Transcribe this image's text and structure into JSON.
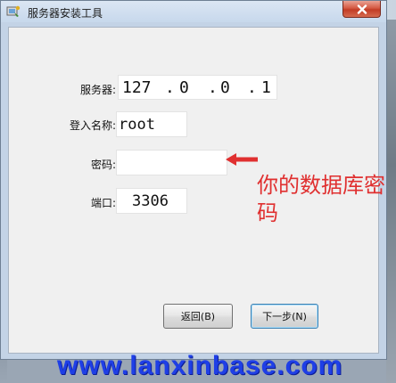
{
  "window": {
    "title": "服务器安装工具",
    "close_icon": "close-icon"
  },
  "form": {
    "server": {
      "label": "服务器:",
      "ip": [
        "127",
        "0",
        "0",
        "1"
      ],
      "dot": "."
    },
    "login": {
      "label": "登入名称:",
      "value": "root"
    },
    "password": {
      "label": "密码:",
      "value": ""
    },
    "port": {
      "label": "端口:",
      "value": "3306"
    }
  },
  "buttons": {
    "back": "返回(B)",
    "next": "下一步(N)"
  },
  "annotation": {
    "text": "你的数据库密码",
    "arrow_icon": "arrow-left-icon",
    "color": "#e03030"
  },
  "watermark": {
    "text": "www.lanxinbase.com",
    "color": "#1f3fe6"
  }
}
